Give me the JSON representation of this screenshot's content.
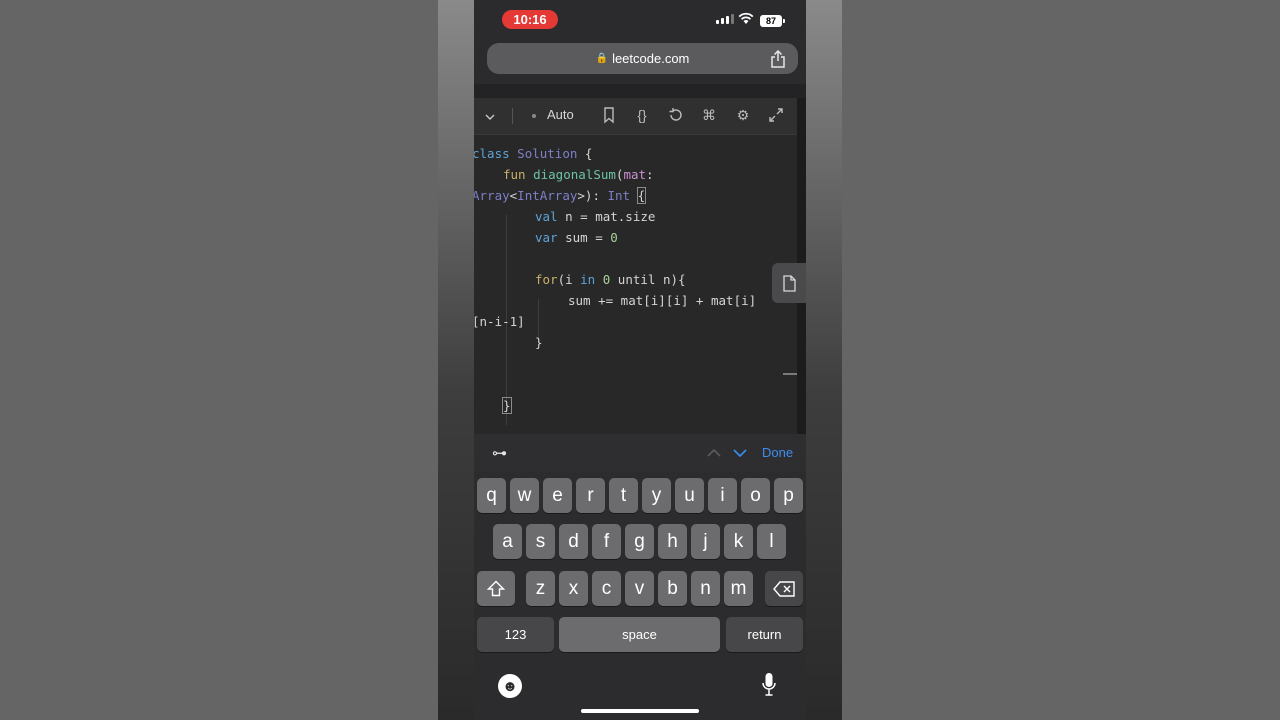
{
  "status_bar": {
    "time": "10:16",
    "battery": "87"
  },
  "browser": {
    "url": "leetcode.com"
  },
  "editor_toolbar": {
    "language_mode": "Auto"
  },
  "code_lines": [
    "class Solution {",
    "    fun diagonalSum(mat:",
    "Array<IntArray>): Int {",
    "        val n = mat.size",
    "        var sum = 0",
    "",
    "        for(i in 0 until n){",
    "            sum += mat[i][i] + mat[i]",
    "[n-i-1]",
    "        }",
    "",
    "",
    "    }"
  ],
  "accessory_bar": {
    "done_label": "Done"
  },
  "keyboard": {
    "row1": [
      "q",
      "w",
      "e",
      "r",
      "t",
      "y",
      "u",
      "i",
      "o",
      "p"
    ],
    "row2": [
      "a",
      "s",
      "d",
      "f",
      "g",
      "h",
      "j",
      "k",
      "l"
    ],
    "row3": [
      "z",
      "x",
      "c",
      "v",
      "b",
      "n",
      "m"
    ],
    "numbers_label": "123",
    "space_label": "space",
    "return_label": "return"
  },
  "icons": {
    "lock": "lock-icon",
    "share": "share-icon",
    "chevron": "chevron-down-icon",
    "bookmark": "bookmark-icon",
    "braces": "braces-icon",
    "reset": "reset-icon",
    "command": "command-icon",
    "settings": "gear-icon",
    "expand": "expand-icon",
    "file": "file-icon",
    "key": "key-icon",
    "emoji": "emoji-icon",
    "mic": "microphone-icon",
    "shift": "shift-icon",
    "backspace": "backspace-icon"
  },
  "colors": {
    "accent": "#3b8ef0",
    "time_pill": "#e53935"
  }
}
